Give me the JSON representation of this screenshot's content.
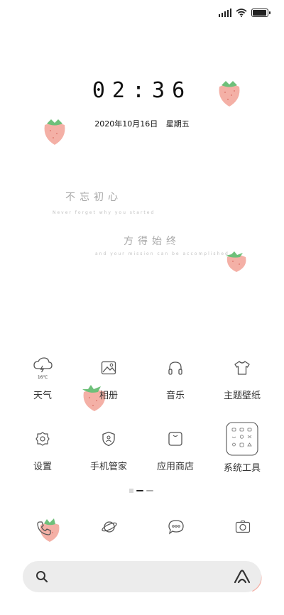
{
  "status_bar": {
    "signal_icon": "signal-icon",
    "wifi_icon": "wifi-icon",
    "battery_icon": "battery-icon",
    "battery_level": 0.85
  },
  "lockclock": {
    "time": "02:36",
    "date": "2020年10月16日",
    "weekday": "星期五"
  },
  "quotes": [
    {
      "main": "不忘初心",
      "sub": "Never forget why you started"
    },
    {
      "main": "方得始终",
      "sub": "and your mission can be accomplished"
    }
  ],
  "apps": [
    {
      "label": "天气",
      "icon": "weather-icon",
      "temp": "16℃"
    },
    {
      "label": "相册",
      "icon": "gallery-icon"
    },
    {
      "label": "音乐",
      "icon": "headphones-icon"
    },
    {
      "label": "主题壁纸",
      "icon": "tshirt-icon"
    },
    {
      "label": "设置",
      "icon": "settings-icon"
    },
    {
      "label": "手机管家",
      "icon": "shield-icon"
    },
    {
      "label": "应用商店",
      "icon": "store-icon"
    },
    {
      "label": "系统工具",
      "icon": "folder-icon"
    }
  ],
  "dock": [
    {
      "icon": "phone-icon"
    },
    {
      "icon": "browser-planet-icon"
    },
    {
      "icon": "messages-icon"
    },
    {
      "icon": "camera-icon"
    }
  ],
  "search": {
    "icon": "search-icon",
    "assistant_icon": "assistant-icon"
  },
  "colors": {
    "berry": "#f4a9a0",
    "leaf": "#6ec07a",
    "icon_stroke": "#555555",
    "search_bg": "#ececec"
  }
}
